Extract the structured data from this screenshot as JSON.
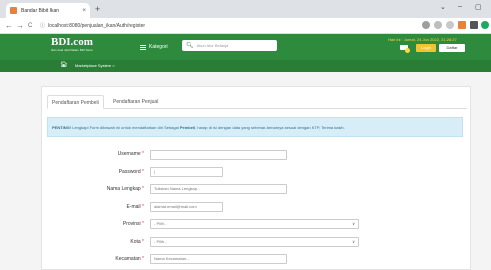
{
  "browser": {
    "tab_title": "Bandar Bibit Ikan",
    "tab_close": "×",
    "new_tab": "+",
    "url_secure": "ⓘ",
    "url": "localhost:8080/penjualan_ikan/Auth/register",
    "window_controls": [
      "⌄",
      "–",
      "▢"
    ],
    "nav": [
      "←",
      "→",
      "C"
    ]
  },
  "header": {
    "logo_main": "BDI.com",
    "logo_sub": "Ikan Asal Jadi Dalam BDI Store",
    "kategori_label": "Kategori",
    "search_placeholder": "Akun Alur Belanja",
    "datetime": "Hari ini : Jumat, 24 Jun 2022, 21:28:27",
    "login_label": "Login",
    "daftar_label": "Daftar"
  },
  "subnav": {
    "marketplace_label": "Marketplace System  >"
  },
  "tabs": [
    {
      "label": "Pendaftaran Pembeli",
      "active": true
    },
    {
      "label": "Pendaftaran Penjual",
      "active": false
    }
  ],
  "alert": {
    "strong": "PENTING!",
    "text": " Lengkapi Form dibawah ini untuk mendaftarkan diri Sebagai ",
    "strong2": "Pembeli",
    "text2": ", harap di isi dengan data yang sebenar-benarnya sesuai dengan KTP, Terima kasih."
  },
  "form": {
    "required_mark": "*",
    "fields": [
      {
        "label": "Username",
        "value": ""
      },
      {
        "label": "Password",
        "value": "|"
      },
      {
        "label": "Nama Lengkap",
        "value": "Tuliskan Nama Lengkap..."
      },
      {
        "label": "E-mail",
        "value": "alamat.email@mail.com"
      },
      {
        "label": "Provinsi",
        "value": "- Pilih -"
      },
      {
        "label": "Kota",
        "value": "- Pilih -"
      },
      {
        "label": "Kecamatan",
        "value": "Nama Kecamatan..."
      }
    ]
  },
  "colors": {
    "brand_green": "#2e8b3e",
    "accent_yellow": "#f4c430",
    "alert_bg": "#d7edf7"
  }
}
